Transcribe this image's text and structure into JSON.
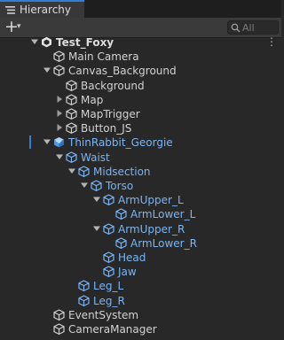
{
  "window": {
    "tab_title": "Hierarchy",
    "tab_icon": "list-icon"
  },
  "toolbar": {
    "add_label": "+",
    "add_dropdown": "▾",
    "search_placeholder": "All",
    "search_value": ""
  },
  "colors": {
    "panel_bg": "#282828",
    "tab_bg": "#383838",
    "toolbar_bg": "#3a3a3a",
    "prefab_text": "#7ab5f5",
    "normal_text": "#d2d2d2",
    "selection_accent": "#2f7ed8"
  },
  "hierarchy": [
    {
      "name": "Test_Foxy",
      "depth": 0,
      "expand": "open",
      "icon": "unity-scene-icon",
      "style": "bold",
      "menu": "⋮"
    },
    {
      "name": "Main Camera",
      "depth": 1,
      "expand": "none",
      "icon": "gameobject-icon",
      "style": "normal"
    },
    {
      "name": "Canvas_Background",
      "depth": 1,
      "expand": "open",
      "icon": "gameobject-icon",
      "style": "normal"
    },
    {
      "name": "Background",
      "depth": 2,
      "expand": "none",
      "icon": "gameobject-icon",
      "style": "normal"
    },
    {
      "name": "Map",
      "depth": 2,
      "expand": "closed",
      "icon": "gameobject-icon",
      "style": "normal"
    },
    {
      "name": "MapTrigger",
      "depth": 2,
      "expand": "closed",
      "icon": "gameobject-icon",
      "style": "normal"
    },
    {
      "name": "Button_JS",
      "depth": 2,
      "expand": "closed",
      "icon": "gameobject-icon",
      "style": "normal"
    },
    {
      "name": "ThinRabbit_Georgie",
      "depth": 1,
      "expand": "open",
      "icon": "prefab-model-icon",
      "style": "prefab"
    },
    {
      "name": "Waist",
      "depth": 2,
      "expand": "open",
      "icon": "gameobject-icon",
      "style": "prefab"
    },
    {
      "name": "Midsection",
      "depth": 3,
      "expand": "open",
      "icon": "gameobject-icon",
      "style": "prefab"
    },
    {
      "name": "Torso",
      "depth": 4,
      "expand": "open",
      "icon": "gameobject-icon",
      "style": "prefab"
    },
    {
      "name": "ArmUpper_L",
      "depth": 5,
      "expand": "open",
      "icon": "gameobject-icon",
      "style": "prefab"
    },
    {
      "name": "ArmLower_L",
      "depth": 6,
      "expand": "none",
      "icon": "gameobject-icon",
      "style": "prefab"
    },
    {
      "name": "ArmUpper_R",
      "depth": 5,
      "expand": "open",
      "icon": "gameobject-icon",
      "style": "prefab"
    },
    {
      "name": "ArmLower_R",
      "depth": 6,
      "expand": "none",
      "icon": "gameobject-icon",
      "style": "prefab"
    },
    {
      "name": "Head",
      "depth": 5,
      "expand": "none",
      "icon": "gameobject-icon",
      "style": "prefab"
    },
    {
      "name": "Jaw",
      "depth": 5,
      "expand": "none",
      "icon": "gameobject-icon",
      "style": "prefab"
    },
    {
      "name": "Leg_L",
      "depth": 3,
      "expand": "none",
      "icon": "gameobject-icon",
      "style": "prefab"
    },
    {
      "name": "Leg_R",
      "depth": 3,
      "expand": "none",
      "icon": "gameobject-icon",
      "style": "prefab"
    },
    {
      "name": "EventSystem",
      "depth": 1,
      "expand": "none",
      "icon": "gameobject-icon",
      "style": "normal"
    },
    {
      "name": "CameraManager",
      "depth": 1,
      "expand": "none",
      "icon": "gameobject-icon",
      "style": "normal"
    }
  ]
}
